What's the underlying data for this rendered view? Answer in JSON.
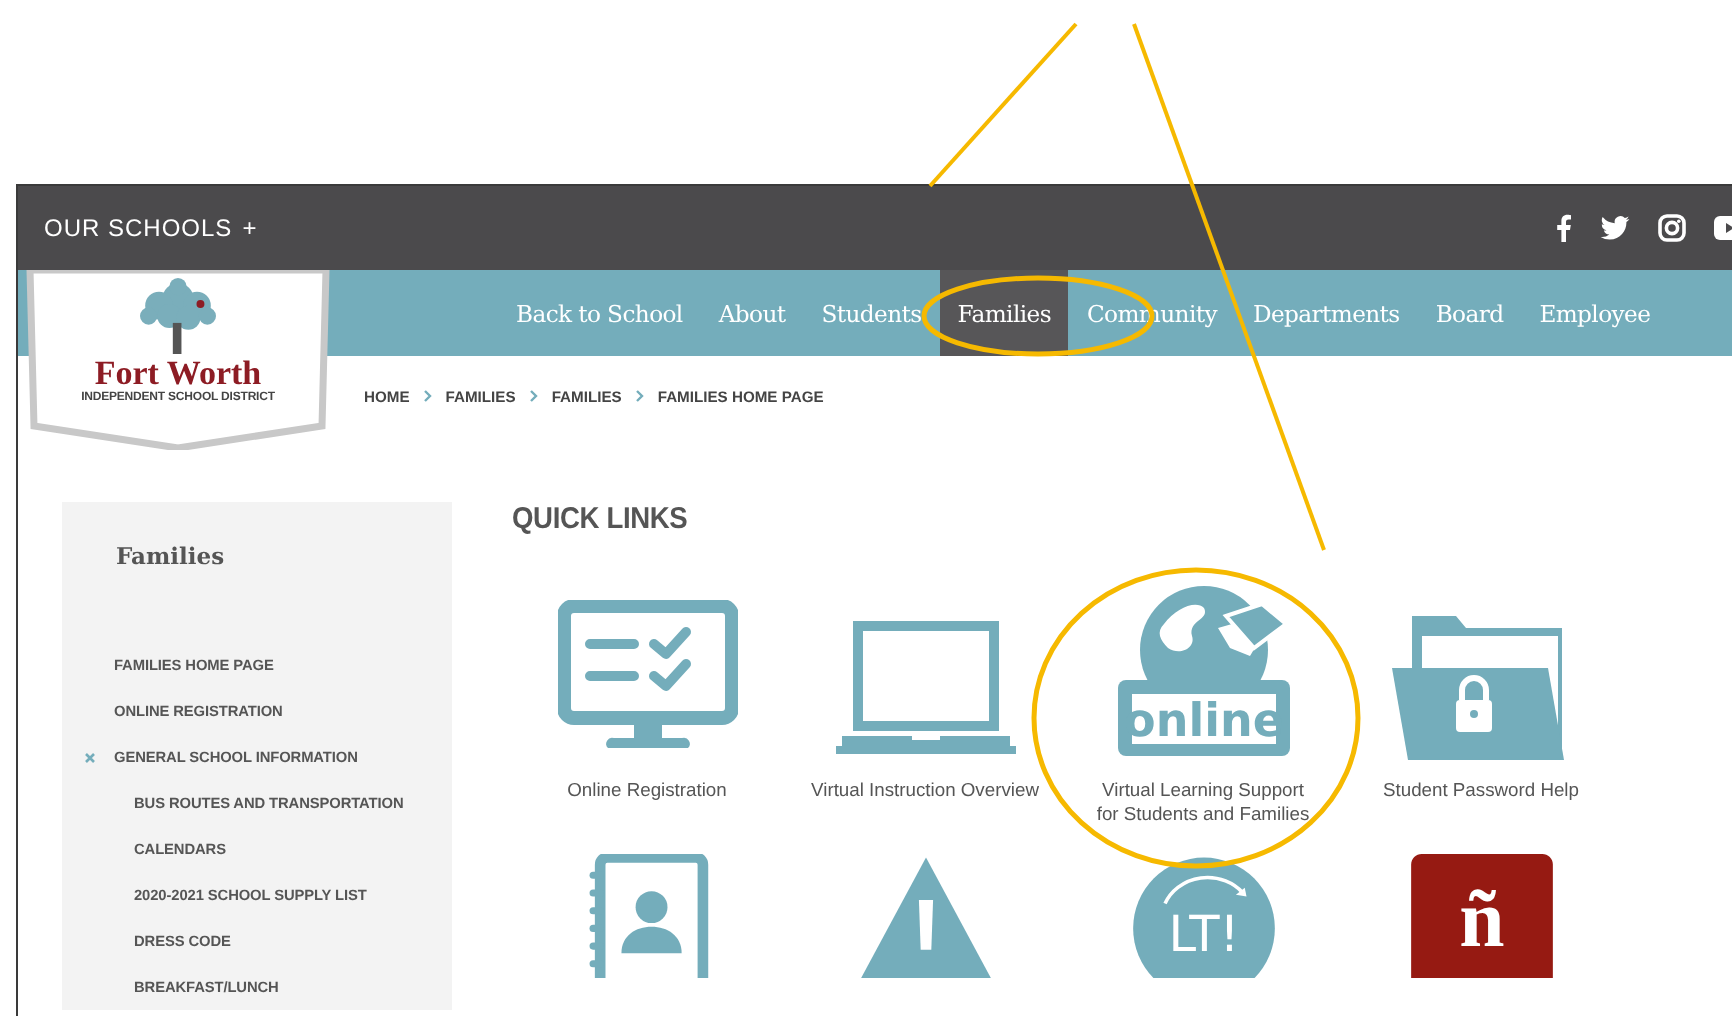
{
  "top_bar": {
    "schools_menu": "OUR SCHOOLS",
    "schools_toggle": "+"
  },
  "logo": {
    "name": "Fort Worth",
    "subtitle": "INDEPENDENT SCHOOL DISTRICT"
  },
  "nav": [
    {
      "label": "Back to School",
      "selected": false
    },
    {
      "label": "About",
      "selected": false
    },
    {
      "label": "Students",
      "selected": false
    },
    {
      "label": "Families",
      "selected": true
    },
    {
      "label": "Community",
      "selected": false
    },
    {
      "label": "Departments",
      "selected": false
    },
    {
      "label": "Board",
      "selected": false
    },
    {
      "label": "Employee",
      "selected": false
    }
  ],
  "breadcrumb": [
    "HOME",
    "FAMILIES",
    "FAMILIES",
    "FAMILIES HOME PAGE"
  ],
  "sidebar": {
    "title": "Families",
    "items": [
      {
        "label": "FAMILIES HOME PAGE",
        "expanded": false
      },
      {
        "label": "ONLINE REGISTRATION",
        "expanded": false
      },
      {
        "label": "GENERAL SCHOOL INFORMATION",
        "expanded": true,
        "children": [
          {
            "label": "BUS ROUTES AND TRANSPORTATION"
          },
          {
            "label": "CALENDARS"
          },
          {
            "label": "2020-2021 SCHOOL SUPPLY LIST"
          },
          {
            "label": "DRESS CODE"
          },
          {
            "label": "BREAKFAST/LUNCH"
          }
        ]
      }
    ]
  },
  "quick_links": {
    "title": "QUICK LINKS",
    "items": [
      {
        "kind": "monitor-checklist",
        "label": "Online Registration"
      },
      {
        "kind": "laptop",
        "label": "Virtual Instruction Overview"
      },
      {
        "kind": "globe-online",
        "icon_text": "online",
        "label": "Virtual Learning Support for Students and Families"
      },
      {
        "kind": "folder-lock",
        "label": "Student Password Help"
      },
      {
        "kind": "contact-book"
      },
      {
        "kind": "warning"
      },
      {
        "kind": "lt-circle",
        "icon_text": "LT!"
      },
      {
        "kind": "letter-tile",
        "icon_text": "ñ"
      }
    ]
  }
}
